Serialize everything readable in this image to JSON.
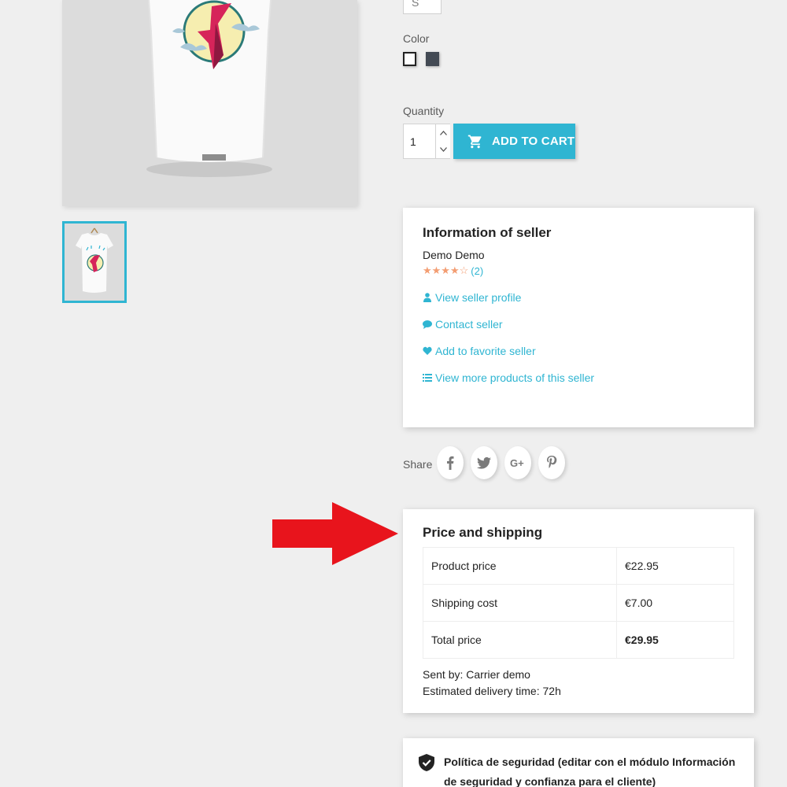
{
  "product": {
    "size_value": "S",
    "color_label": "Color",
    "colors": [
      "#ffffff",
      "#434a54"
    ],
    "quantity_label": "Quantity",
    "quantity_value": "1",
    "add_to_cart_label": "ADD TO CART"
  },
  "seller": {
    "heading": "Information of seller",
    "name": "Demo Demo",
    "stars": "★★★★☆",
    "rating_score": 4,
    "rating_max": 5,
    "reviews": "(2)",
    "links": {
      "profile": "View seller profile",
      "contact": "Contact seller",
      "favorite": "Add to favorite seller",
      "more_products": "View more products of this seller"
    }
  },
  "share": {
    "label": "Share",
    "networks": [
      "facebook",
      "twitter",
      "google-plus",
      "pinterest"
    ]
  },
  "price_shipping": {
    "heading": "Price and shipping",
    "rows": [
      {
        "label": "Product price",
        "value": "€22.95"
      },
      {
        "label": "Shipping cost",
        "value": "€7.00"
      },
      {
        "label": "Total price",
        "value": "€29.95"
      }
    ],
    "sent_by": "Sent by: Carrier demo",
    "delivery": "Estimated delivery time: 72h"
  },
  "policy": {
    "text": "Política de seguridad (editar con el módulo Información de seguridad y confianza para el cliente)"
  },
  "colors": {
    "accent": "#2fb5d2",
    "star": "#f39d72",
    "arrow": "#e8141c"
  }
}
